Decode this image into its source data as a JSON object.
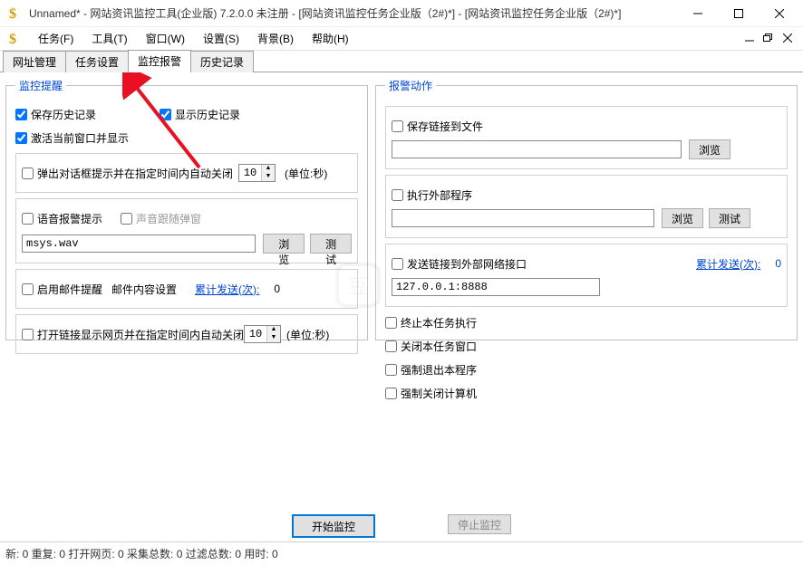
{
  "titlebar": {
    "title": "Unnamed* - 网站资讯监控工具(企业版) 7.2.0.0  未注册 - [网站资讯监控任务企业版（2#)*] - [网站资讯监控任务企业版（2#)*]"
  },
  "menu": {
    "task": "任务(F)",
    "tools": "工具(T)",
    "window": "窗口(W)",
    "settings": "设置(S)",
    "background": "背景(B)",
    "help": "帮助(H)"
  },
  "tabs": {
    "t1": "网址管理",
    "t2": "任务设置",
    "t3": "监控报警",
    "t4": "历史记录"
  },
  "left": {
    "legend": "监控提醒",
    "save_history": "保存历史记录",
    "show_history": "显示历史记录",
    "activate_window": "激活当前窗口并显示",
    "popup_close": "弹出对话框提示并在指定时间内自动关闭",
    "popup_seconds": "10",
    "unit_seconds": "(单位:秒)",
    "voice_alarm": "语音报警提示",
    "sound_follow": "声音跟随弹窗",
    "sound_file": "msys.wav",
    "browse": "浏览",
    "test": "测试",
    "enable_mail": "启用邮件提醒",
    "mail_settings": "邮件内容设置",
    "send_count_label": "累计发送(次):",
    "send_count": "0",
    "open_link_close": "打开链接显示网页并在指定时间内自动关闭",
    "open_link_seconds": "10",
    "unit_seconds2": "(单位:秒)"
  },
  "right": {
    "legend": "报警动作",
    "save_link_file": "保存链接到文件",
    "browse": "浏览",
    "exec_external": "执行外部程序",
    "test": "测试",
    "send_link_external": "发送链接到外部网络接口",
    "send_count_label": "累计发送(次):",
    "send_count": "0",
    "address": "127.0.0.1:8888",
    "stop_task": "终止本任务执行",
    "close_task_window": "关闭本任务窗口",
    "force_exit": "强制退出本程序",
    "force_shutdown": "强制关闭计算机"
  },
  "bottom": {
    "start": "开始监控",
    "stop": "停止监控"
  },
  "status": {
    "text": "新:  0  重复:  0  打开网页:  0   采集总数:  0  过滤总数:  0  用时:  0"
  }
}
